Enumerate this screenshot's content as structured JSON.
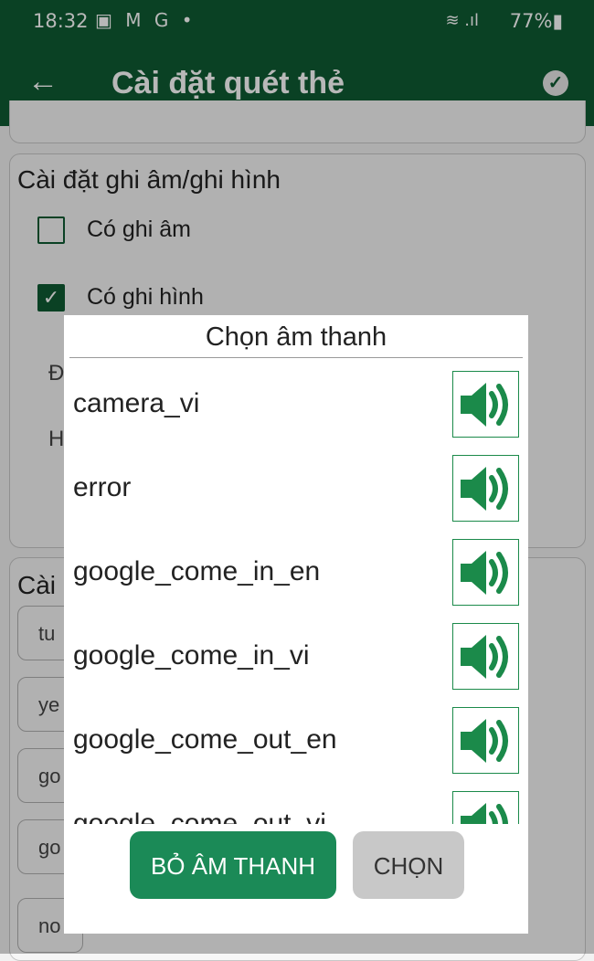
{
  "status_bar": {
    "time": "18:32",
    "notification_icons": "▣ M G •",
    "signal": "≋ .ıl",
    "battery": "77%▮"
  },
  "app_bar": {
    "title": "Cài đặt quét thẻ",
    "back_icon": "←",
    "confirm_icon": "✓"
  },
  "settings": {
    "record_section_title": "Cài đặt ghi âm/ghi hình",
    "record_audio_label": "Có ghi âm",
    "record_audio_checked": false,
    "record_video_label": "Có ghi hình",
    "record_video_checked": true,
    "hidden_label_1": "Đ",
    "hidden_label_2": "H",
    "sound_section_title": "Cài",
    "chips": [
      "tu",
      "ye",
      "go",
      "go",
      "no"
    ]
  },
  "dialog": {
    "title": "Chọn âm thanh",
    "sounds": [
      {
        "name": "camera_vi"
      },
      {
        "name": "error"
      },
      {
        "name": "google_come_in_en"
      },
      {
        "name": "google_come_in_vi"
      },
      {
        "name": "google_come_out_en"
      },
      {
        "name": "google_come_out_vi"
      }
    ],
    "play_icon": "speaker-icon",
    "clear_button": "BỎ ÂM THANH",
    "select_button": "CHỌN"
  },
  "colors": {
    "primary": "#0e5a33",
    "accent": "#1b8a57",
    "icon_green": "#1b8a4a"
  }
}
